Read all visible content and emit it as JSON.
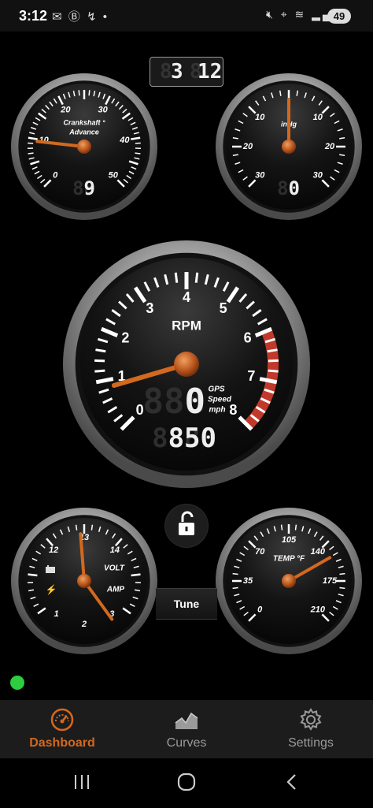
{
  "status_bar": {
    "time": "3:12",
    "notification_icons": [
      "mail-icon",
      "b-app-icon",
      "trend-icon",
      "dot-icon"
    ],
    "system_icons": [
      "mute-icon",
      "location-icon",
      "wifi-icon",
      "signal-icon"
    ],
    "battery_level": "49"
  },
  "clock": {
    "hour": "3",
    "minute": "12"
  },
  "gauges": {
    "crankshaft": {
      "label_line1": "Crankshaft °",
      "label_line2": "Advance",
      "ticks": [
        "0",
        "10",
        "20",
        "30",
        "40",
        "50"
      ],
      "readout": "9",
      "needle_value": 9.5,
      "min": 0,
      "max": 50
    },
    "vacuum": {
      "label": "inHg",
      "ticks_left": [
        "30",
        "20",
        "10"
      ],
      "ticks_right": [
        "10",
        "20",
        "30"
      ],
      "readout": "0",
      "needle_value": 0,
      "min": -30,
      "max": 30
    },
    "tach": {
      "label": "RPM",
      "ticks": [
        "0",
        "1",
        "2",
        "3",
        "4",
        "5",
        "6",
        "7",
        "8"
      ],
      "rpm_readout": "850",
      "speed_readout": "0",
      "speed_label_line1": "GPS",
      "speed_label_line2": "Speed",
      "speed_label_line3": "mph",
      "needle_value": 0.85,
      "min": 0,
      "max": 8,
      "redline": 6
    },
    "voltamp": {
      "volt_label": "VOLT",
      "amp_label": "AMP",
      "volt_ticks": [
        "12",
        "13",
        "14"
      ],
      "amp_ticks": [
        "1",
        "2",
        "3"
      ],
      "volt_value": 12.9,
      "amp_value": 2.9
    },
    "temp": {
      "label": "TEMP °F",
      "ticks": [
        "0",
        "35",
        "70",
        "105",
        "140",
        "175",
        "210"
      ],
      "needle_value": 152,
      "min": 0,
      "max": 210
    }
  },
  "tune_button": "Tune",
  "connection_status_color": "#2ecc40",
  "accent_color": "#d2691e",
  "tabs": [
    {
      "label": "Dashboard",
      "icon": "speedometer-icon",
      "active": true
    },
    {
      "label": "Curves",
      "icon": "curve-chart-icon",
      "active": false
    },
    {
      "label": "Settings",
      "icon": "gear-icon",
      "active": false
    }
  ],
  "nav_buttons": [
    "recent-apps-icon",
    "home-icon",
    "back-icon"
  ]
}
